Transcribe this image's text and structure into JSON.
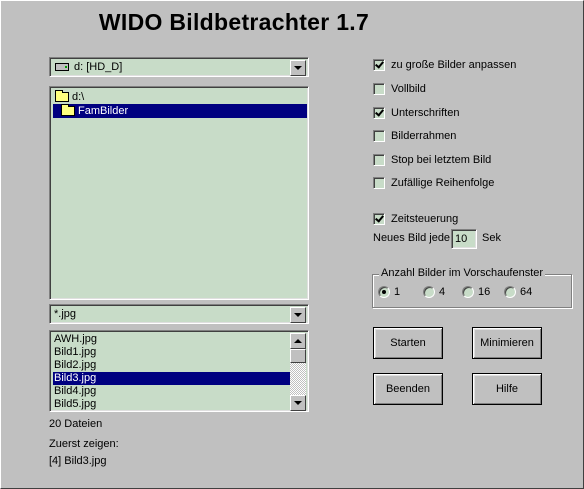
{
  "app": {
    "title": "WIDO Bildbetrachter 1.7"
  },
  "drive": {
    "value": "d: [HD_D]"
  },
  "directories": [
    {
      "label": "d:\\",
      "selected": false
    },
    {
      "label": "FamBilder",
      "selected": true
    }
  ],
  "filter": {
    "value": "*.jpg"
  },
  "files": [
    {
      "label": "AWH.jpg",
      "selected": false
    },
    {
      "label": "Bild1.jpg",
      "selected": false
    },
    {
      "label": "Bild2.jpg",
      "selected": false
    },
    {
      "label": "Bild3.jpg",
      "selected": true
    },
    {
      "label": "Bild4.jpg",
      "selected": false
    },
    {
      "label": "Bild5.jpg",
      "selected": false
    }
  ],
  "status": {
    "file_count": "20 Dateien",
    "first_show_label": "Zuerst zeigen:",
    "first_show_value": "[4] Bild3.jpg"
  },
  "options": [
    {
      "label": "zu große Bilder anpassen",
      "checked": true
    },
    {
      "label": "Vollbild",
      "checked": false
    },
    {
      "label": "Unterschriften",
      "checked": true
    },
    {
      "label": "Bilderrahmen",
      "checked": false
    },
    {
      "label": "Stop bei letztem Bild",
      "checked": false
    },
    {
      "label": "Zufällige Reihenfolge",
      "checked": false
    }
  ],
  "timer": {
    "label": "Zeitsteuerung",
    "checked": true,
    "interval_prefix": "Neues Bild jede",
    "interval_value": "10",
    "interval_unit": "Sek"
  },
  "preview": {
    "title": "Anzahl Bilder im Vorschaufenster",
    "options": [
      "1",
      "4",
      "16",
      "64"
    ],
    "selected": "1"
  },
  "buttons": {
    "start": "Starten",
    "minimize": "Minimieren",
    "quit": "Beenden",
    "help": "Hilfe"
  }
}
